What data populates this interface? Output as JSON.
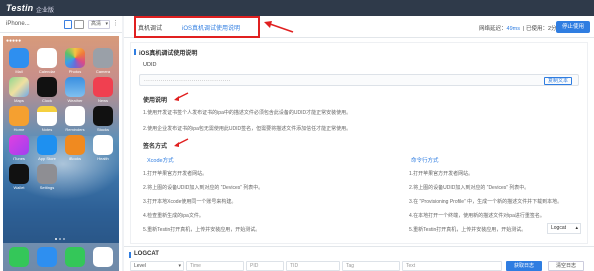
{
  "app": {
    "logo": "Testin",
    "edition": "企业版"
  },
  "device": {
    "name": "iPhone...",
    "quality": "高清"
  },
  "phone": {
    "status_left": "●●●●● ",
    "status_time": "",
    "status_right": "",
    "apps_row1": [
      "Mail",
      "Calendar",
      "Photos",
      "Camera"
    ],
    "apps_row2": [
      "Maps",
      "Clock",
      "Weather",
      "News"
    ],
    "apps_row3": [
      "Home",
      "Notes",
      "Reminders",
      "Stocks"
    ],
    "apps_row4": [
      "iTunes",
      "App Store",
      "iBooks",
      "Health"
    ],
    "apps_row5": [
      "Wallet",
      "Settings"
    ],
    "dock": [
      "Phone",
      "Safari",
      "Messages",
      "Music"
    ]
  },
  "tabs": {
    "real_test": "真机调试",
    "ios_guide": "iOS真机调试使用说明"
  },
  "network": {
    "label": "网络延迟：",
    "latency": "49ms",
    "used_label": "已使用：",
    "used": "2分钟36秒"
  },
  "stop_button": "停止使用",
  "guide": {
    "title": "iOS真机调试使用说明",
    "udid_label": "UDID",
    "udid_value": "··········································",
    "copy": "复制文本",
    "usage_title": "使用说明",
    "usage_1": "1.使用开发证书签个人发布证书的ipa中的描述文件必须包含此设备的UDID才能正常安装使用。",
    "usage_2": "2.使用企业发布证书的ipa包无需使用此UDID签名，但需要将描述文件添加信任才能正常使用。",
    "sign_title": "签名方式",
    "xcode_head": "Xcode方式",
    "xcode_steps": [
      "1.打开苹果官方开发者网站。",
      "2.将上图的设备UDID加入到对应的 “Devices” 列表中。",
      "3.打开本地Xcode使用同一个账号来构建。",
      "4.检查重新生成的ipa文件。",
      "5.重新Testin打开真机，上传并安装应用，开始测试。"
    ],
    "cmd_head": "命令行方式",
    "cmd_steps": [
      "1.打开苹果官方开发者网站。",
      "2.将上图的设备UDID加入到对应的 “Devices” 列表中。",
      "3.在 “Provisioning Profile” 中，生成一个新的描述文件并下载到本地。",
      "4.在本地打开一个终端，使用新的描述文件对ipa进行重签名。",
      "5.重新Testin打开真机，上传并安装应用，开始测试。"
    ],
    "logcat_tag": "Logcat"
  },
  "logcat": {
    "title": "LOGCAT",
    "level": "Level",
    "time_placeholder": "Time",
    "pid_placeholder": "PID",
    "tid_placeholder": "TID",
    "tag_placeholder": "Tag",
    "text_placeholder": "Text",
    "fetch": "获取日志",
    "clear": "清空日志"
  },
  "colors": {
    "accent": "#2f7de1",
    "annotation": "#e02020",
    "topbar": "#2f3a4a"
  }
}
